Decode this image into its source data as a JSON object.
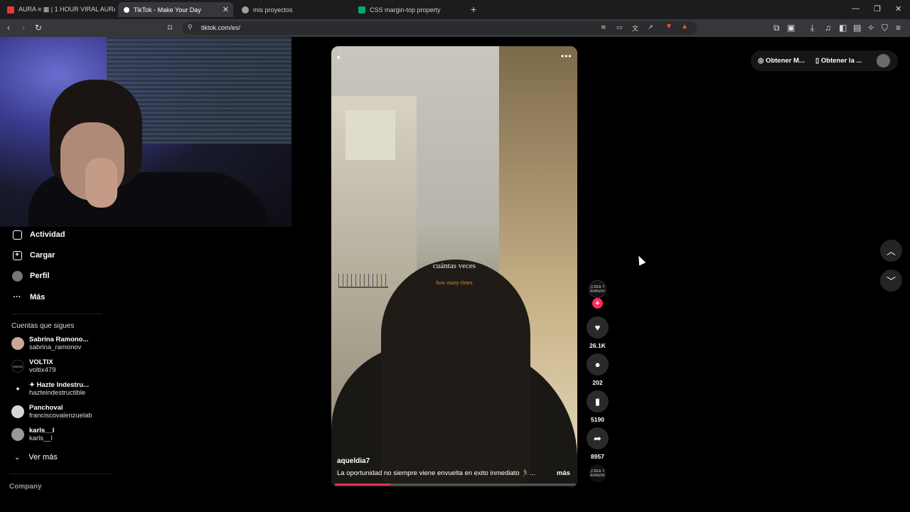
{
  "browser": {
    "tabs": [
      {
        "title": "AURA ≡ ▦ | 1 HOUR VIRAL AURA M",
        "favicon_color": "#e53935"
      },
      {
        "title": "TikTok - Make Your Day",
        "favicon_color": "#ffffff"
      },
      {
        "title": "mis proyectos",
        "favicon_color": "#9e9e9e"
      },
      {
        "title": "CSS margin-top property",
        "favicon_color": "#04aa6d"
      }
    ],
    "url": "tiktok.com/es/",
    "new_tab_symbol": "+",
    "window_controls": [
      "—",
      "❐",
      "✕"
    ]
  },
  "sidebar": {
    "nav": [
      {
        "label": "Actividad",
        "icon": "activity-icon"
      },
      {
        "label": "Cargar",
        "icon": "upload-icon"
      },
      {
        "label": "Perfil",
        "icon": "profile-avatar"
      },
      {
        "label": "Más",
        "icon": "more-dots-icon"
      }
    ],
    "following_heading": "Cuentas que sigues",
    "following": [
      {
        "name": "Sabrina Ramono...",
        "handle": "sabrina_ramonov",
        "avatar_color": "#c9a79b"
      },
      {
        "name": "VOLTIX",
        "handle": "voltix479",
        "avatar_color": "#000000",
        "avatar_text": "VOLTIX"
      },
      {
        "name": "✦ Hazte Indestru...",
        "handle": "hazteindestructible",
        "avatar_color": "#000000",
        "avatar_text": "✦"
      },
      {
        "name": "Panchoval",
        "handle": "franciscovalenzuelab",
        "avatar_color": "#d6d6d6"
      },
      {
        "name": "karls__l",
        "handle": "karls__l",
        "avatar_color": "#999999"
      }
    ],
    "see_more": "Ver más",
    "footer": "Company"
  },
  "video": {
    "caption_line1": "cuántas veces",
    "caption_line2": "how many times",
    "author": "aqueldia7",
    "description": "La oportunidad no siempre viene envuelta en exito inmediato 🏃🏽...",
    "more": "más",
    "progress": 0.23
  },
  "actions": {
    "creator_avatar_text": "¡CREE Y AVANZA!",
    "likes": "26.1K",
    "comments": "202",
    "saves": "5190",
    "shares": "8957",
    "music_disc_text": "¡CREE Y AVANZA!"
  },
  "topright": {
    "get_coins": "Obtener M...",
    "get_app": "Obtener la ..."
  },
  "colors": {
    "accent": "#fe2c55",
    "background": "#000000"
  }
}
